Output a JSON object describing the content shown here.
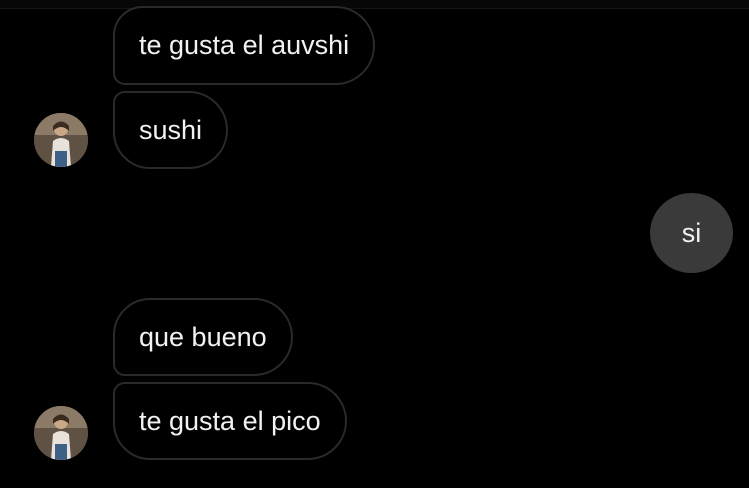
{
  "conversation": {
    "incoming_group_1": [
      {
        "text": "te gusta el auvshi"
      },
      {
        "text": "sushi"
      }
    ],
    "outgoing": [
      {
        "text": "si"
      }
    ],
    "incoming_group_2": [
      {
        "text": "que bueno"
      },
      {
        "text": "te gusta el pico"
      }
    ]
  },
  "colors": {
    "background": "#000000",
    "incoming_bubble_border": "#2a2a2a",
    "outgoing_bubble_fill": "#3a3a3a",
    "text": "#f2f2f2"
  },
  "icons": {
    "sender_avatar": "contact-avatar-photo"
  }
}
